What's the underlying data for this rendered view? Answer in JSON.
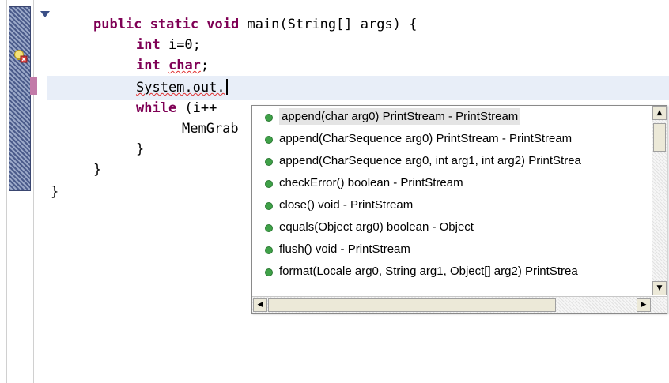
{
  "editor": {
    "code_lines": [
      {
        "pre": "",
        "kw": "public static void",
        "post": " main(String[] args) {"
      },
      {
        "pre": "",
        "kw": "int",
        "post": " i=0;"
      },
      {
        "pre": "",
        "kw": "int",
        "post": " "
      },
      {
        "text": "System.out."
      },
      {
        "pre": "",
        "kw": "while",
        "post": " (i++"
      },
      {
        "text": "MemGrab"
      },
      {
        "text": "}"
      },
      {
        "text": "}"
      },
      {
        "text": "}"
      }
    ],
    "squiggle_word": "char",
    "semicolon": ";"
  },
  "autocomplete": {
    "items": [
      {
        "label": "append(char arg0)  PrintStream - PrintStream",
        "selected": true
      },
      {
        "label": "append(CharSequence arg0)  PrintStream - PrintStream",
        "selected": false
      },
      {
        "label": "append(CharSequence arg0, int arg1, int arg2)  PrintStrea",
        "selected": false
      },
      {
        "label": "checkError()  boolean - PrintStream",
        "selected": false
      },
      {
        "label": "close()  void - PrintStream",
        "selected": false
      },
      {
        "label": "equals(Object arg0)  boolean - Object",
        "selected": false
      },
      {
        "label": "flush()  void - PrintStream",
        "selected": false
      },
      {
        "label": "format(Locale arg0, String arg1, Object[] arg2)  PrintStrea",
        "selected": false
      }
    ],
    "bullet_color": "#3fa148",
    "scroll_up_glyph": "▲",
    "scroll_down_glyph": "▼",
    "scroll_left_glyph": "◀",
    "scroll_right_glyph": "▶"
  },
  "colors": {
    "keyword": "#7f0055",
    "current_line": "#e8eef8",
    "error_marker": "#c27aa8"
  }
}
